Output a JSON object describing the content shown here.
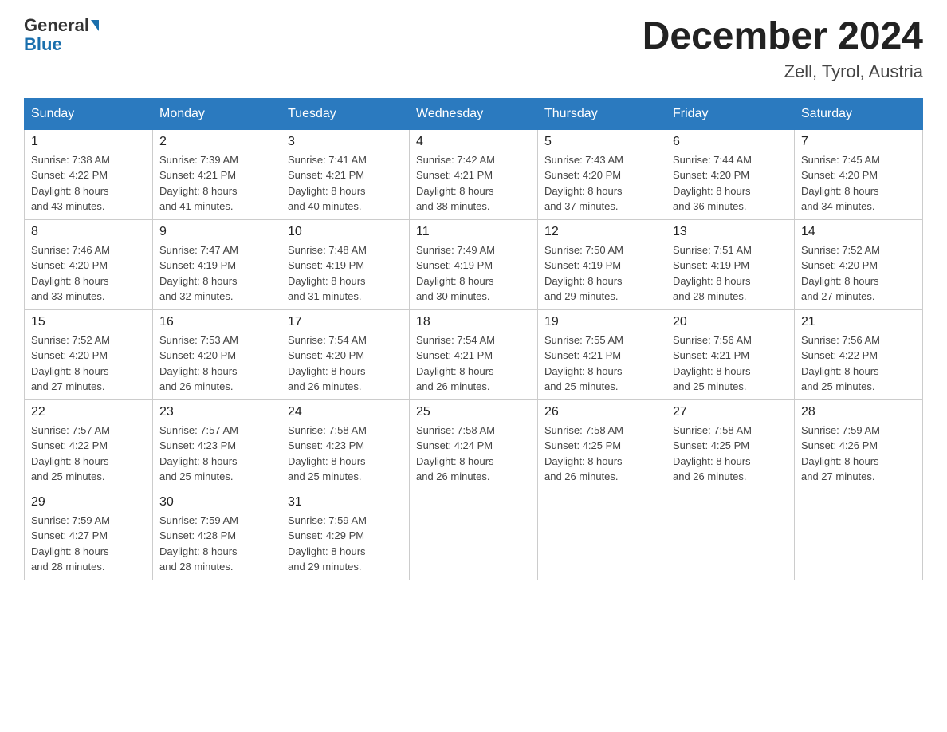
{
  "header": {
    "logo_general": "General",
    "logo_blue": "Blue",
    "title": "December 2024",
    "subtitle": "Zell, Tyrol, Austria"
  },
  "days_of_week": [
    "Sunday",
    "Monday",
    "Tuesday",
    "Wednesday",
    "Thursday",
    "Friday",
    "Saturday"
  ],
  "weeks": [
    [
      {
        "day": "1",
        "sunrise": "7:38 AM",
        "sunset": "4:22 PM",
        "daylight_hours": "8",
        "daylight_minutes": "43"
      },
      {
        "day": "2",
        "sunrise": "7:39 AM",
        "sunset": "4:21 PM",
        "daylight_hours": "8",
        "daylight_minutes": "41"
      },
      {
        "day": "3",
        "sunrise": "7:41 AM",
        "sunset": "4:21 PM",
        "daylight_hours": "8",
        "daylight_minutes": "40"
      },
      {
        "day": "4",
        "sunrise": "7:42 AM",
        "sunset": "4:21 PM",
        "daylight_hours": "8",
        "daylight_minutes": "38"
      },
      {
        "day": "5",
        "sunrise": "7:43 AM",
        "sunset": "4:20 PM",
        "daylight_hours": "8",
        "daylight_minutes": "37"
      },
      {
        "day": "6",
        "sunrise": "7:44 AM",
        "sunset": "4:20 PM",
        "daylight_hours": "8",
        "daylight_minutes": "36"
      },
      {
        "day": "7",
        "sunrise": "7:45 AM",
        "sunset": "4:20 PM",
        "daylight_hours": "8",
        "daylight_minutes": "34"
      }
    ],
    [
      {
        "day": "8",
        "sunrise": "7:46 AM",
        "sunset": "4:20 PM",
        "daylight_hours": "8",
        "daylight_minutes": "33"
      },
      {
        "day": "9",
        "sunrise": "7:47 AM",
        "sunset": "4:19 PM",
        "daylight_hours": "8",
        "daylight_minutes": "32"
      },
      {
        "day": "10",
        "sunrise": "7:48 AM",
        "sunset": "4:19 PM",
        "daylight_hours": "8",
        "daylight_minutes": "31"
      },
      {
        "day": "11",
        "sunrise": "7:49 AM",
        "sunset": "4:19 PM",
        "daylight_hours": "8",
        "daylight_minutes": "30"
      },
      {
        "day": "12",
        "sunrise": "7:50 AM",
        "sunset": "4:19 PM",
        "daylight_hours": "8",
        "daylight_minutes": "29"
      },
      {
        "day": "13",
        "sunrise": "7:51 AM",
        "sunset": "4:19 PM",
        "daylight_hours": "8",
        "daylight_minutes": "28"
      },
      {
        "day": "14",
        "sunrise": "7:52 AM",
        "sunset": "4:20 PM",
        "daylight_hours": "8",
        "daylight_minutes": "27"
      }
    ],
    [
      {
        "day": "15",
        "sunrise": "7:52 AM",
        "sunset": "4:20 PM",
        "daylight_hours": "8",
        "daylight_minutes": "27"
      },
      {
        "day": "16",
        "sunrise": "7:53 AM",
        "sunset": "4:20 PM",
        "daylight_hours": "8",
        "daylight_minutes": "26"
      },
      {
        "day": "17",
        "sunrise": "7:54 AM",
        "sunset": "4:20 PM",
        "daylight_hours": "8",
        "daylight_minutes": "26"
      },
      {
        "day": "18",
        "sunrise": "7:54 AM",
        "sunset": "4:21 PM",
        "daylight_hours": "8",
        "daylight_minutes": "26"
      },
      {
        "day": "19",
        "sunrise": "7:55 AM",
        "sunset": "4:21 PM",
        "daylight_hours": "8",
        "daylight_minutes": "25"
      },
      {
        "day": "20",
        "sunrise": "7:56 AM",
        "sunset": "4:21 PM",
        "daylight_hours": "8",
        "daylight_minutes": "25"
      },
      {
        "day": "21",
        "sunrise": "7:56 AM",
        "sunset": "4:22 PM",
        "daylight_hours": "8",
        "daylight_minutes": "25"
      }
    ],
    [
      {
        "day": "22",
        "sunrise": "7:57 AM",
        "sunset": "4:22 PM",
        "daylight_hours": "8",
        "daylight_minutes": "25"
      },
      {
        "day": "23",
        "sunrise": "7:57 AM",
        "sunset": "4:23 PM",
        "daylight_hours": "8",
        "daylight_minutes": "25"
      },
      {
        "day": "24",
        "sunrise": "7:58 AM",
        "sunset": "4:23 PM",
        "daylight_hours": "8",
        "daylight_minutes": "25"
      },
      {
        "day": "25",
        "sunrise": "7:58 AM",
        "sunset": "4:24 PM",
        "daylight_hours": "8",
        "daylight_minutes": "26"
      },
      {
        "day": "26",
        "sunrise": "7:58 AM",
        "sunset": "4:25 PM",
        "daylight_hours": "8",
        "daylight_minutes": "26"
      },
      {
        "day": "27",
        "sunrise": "7:58 AM",
        "sunset": "4:25 PM",
        "daylight_hours": "8",
        "daylight_minutes": "26"
      },
      {
        "day": "28",
        "sunrise": "7:59 AM",
        "sunset": "4:26 PM",
        "daylight_hours": "8",
        "daylight_minutes": "27"
      }
    ],
    [
      {
        "day": "29",
        "sunrise": "7:59 AM",
        "sunset": "4:27 PM",
        "daylight_hours": "8",
        "daylight_minutes": "28"
      },
      {
        "day": "30",
        "sunrise": "7:59 AM",
        "sunset": "4:28 PM",
        "daylight_hours": "8",
        "daylight_minutes": "28"
      },
      {
        "day": "31",
        "sunrise": "7:59 AM",
        "sunset": "4:29 PM",
        "daylight_hours": "8",
        "daylight_minutes": "29"
      },
      null,
      null,
      null,
      null
    ]
  ],
  "labels": {
    "sunrise": "Sunrise:",
    "sunset": "Sunset:",
    "daylight": "Daylight:",
    "daylight_and": "and",
    "daylight_hours_unit": "hours",
    "daylight_minutes_unit": "minutes."
  }
}
